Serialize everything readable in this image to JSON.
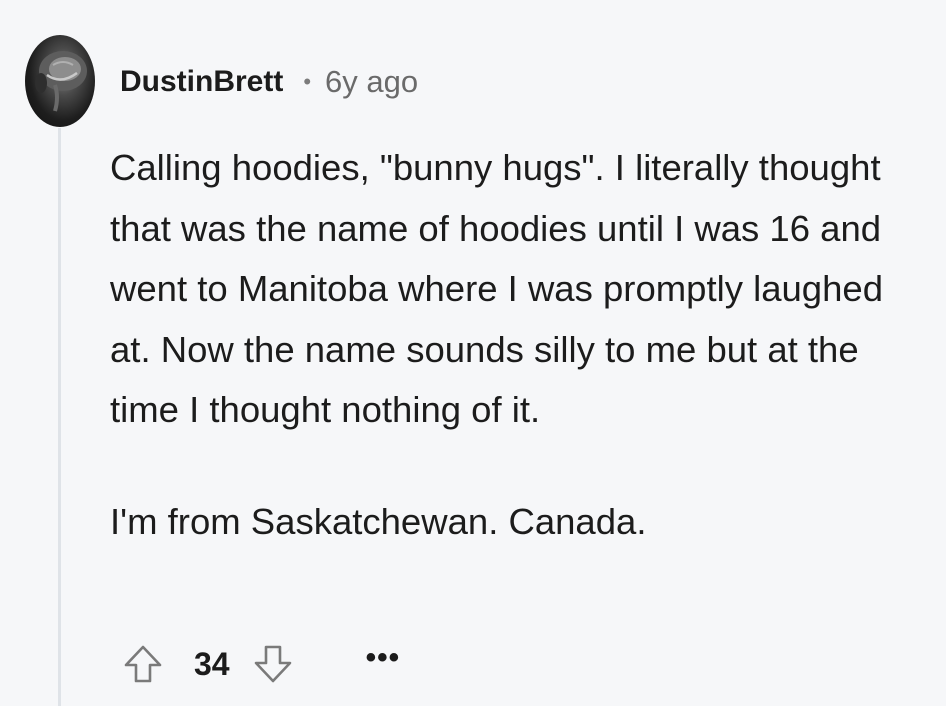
{
  "comment": {
    "author": "DustinBrett",
    "separator": "•",
    "age": "6y ago",
    "paragraphs": [
      "Calling hoodies, \"bunny hugs\". I literally thought that was the name of hoodies until I was 16 and went to Manitoba where I was promptly laughed at. Now the name sounds silly to me but at the time I thought nothing of it.",
      "I'm from Saskatchewan. Canada."
    ],
    "score": "34",
    "more_label": "•••",
    "icons": {
      "upvote": "arrow-up-outline",
      "downvote": "arrow-down-outline",
      "more": "ellipsis-horizontal"
    },
    "colors": {
      "background": "#f6f7f9",
      "thread_line": "#dfe3e8",
      "meta_text": "#6a6a6a"
    }
  }
}
